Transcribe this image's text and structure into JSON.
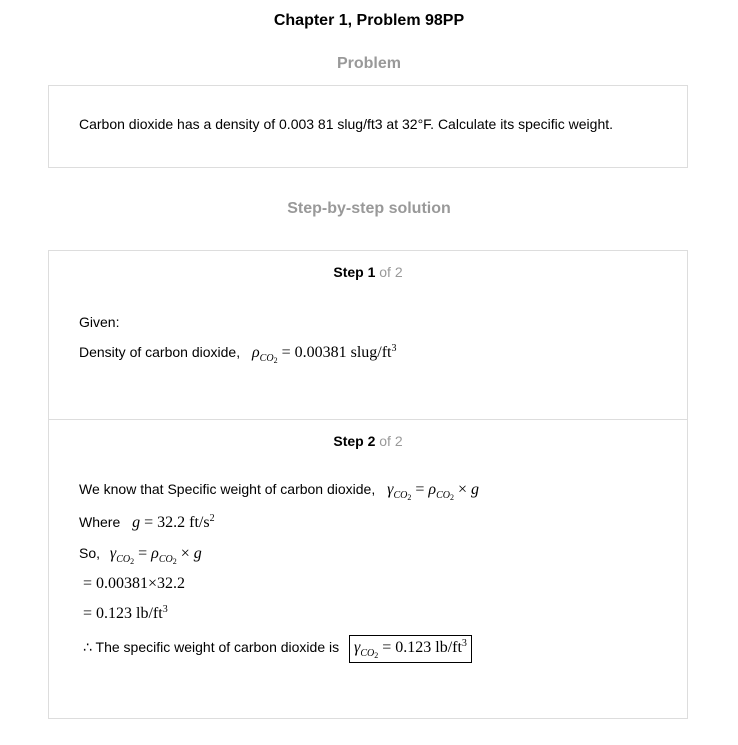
{
  "page": {
    "title": "Chapter 1, Problem 98PP",
    "problem_heading": "Problem",
    "problem_text": "Carbon dioxide has a density of 0.003 81 slug/ft3 at 32°F. Calculate its specific weight.",
    "solution_heading": "Step-by-step solution"
  },
  "steps": [
    {
      "label": "Step 1",
      "of": "of 2",
      "given": "Given:",
      "density_label": "Density of carbon dioxide,",
      "density_value": "= 0.00381 slug/ft"
    },
    {
      "label": "Step 2",
      "of": "of 2",
      "intro": "We know that Specific weight of carbon dioxide,",
      "where_label": "Where",
      "g_value": "= 32.2 ft/s",
      "so_label": "So,",
      "calc_line1": "= 0.00381×32.2",
      "calc_line2": "= 0.123 lb/ft",
      "conclusion": "∴ The specific weight of carbon dioxide is",
      "answer_value": "= 0.123 lb/ft"
    }
  ],
  "colors": {
    "muted": "#999999",
    "border": "#dddddd",
    "text": "#000000"
  }
}
